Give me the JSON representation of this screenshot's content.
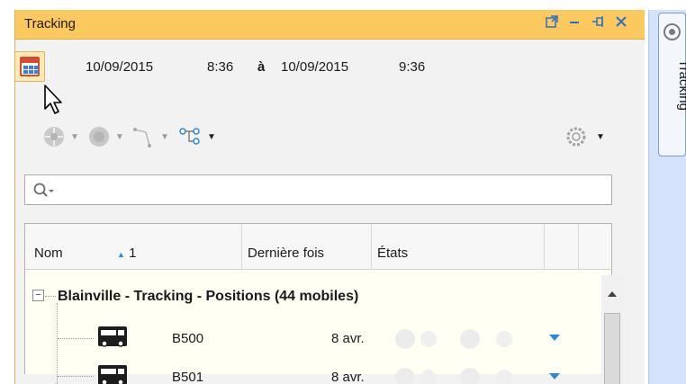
{
  "panel": {
    "title": "Tracking",
    "buttons": [
      "float-icon",
      "minimize-icon",
      "pin-icon",
      "close-icon"
    ]
  },
  "date_range": {
    "start_date": "10/09/2015",
    "start_time": "8:36",
    "separator": "à",
    "end_date": "10/09/2015",
    "end_time": "9:36"
  },
  "toolbar": {
    "icons": [
      "position-icon",
      "circle-icon",
      "route-icon",
      "tree-icon",
      "settings-icon"
    ]
  },
  "search": {
    "value": "",
    "placeholder": ""
  },
  "grid": {
    "columns": [
      "Nom",
      "Dernière fois",
      "États"
    ],
    "sort_index": "1",
    "group": {
      "label": "Blainville - Tracking - Positions (44 mobiles)",
      "expand_symbol": "−"
    },
    "rows": [
      {
        "name": "B500",
        "last_time": "8 avr."
      },
      {
        "name": "B501",
        "last_time": "8 avr."
      }
    ]
  },
  "side_tab": {
    "label": "Tracking"
  },
  "colors": {
    "title_bar": "#fcc95e",
    "accent": "#2a8ad8",
    "side_bar": "#d4e3fb"
  }
}
